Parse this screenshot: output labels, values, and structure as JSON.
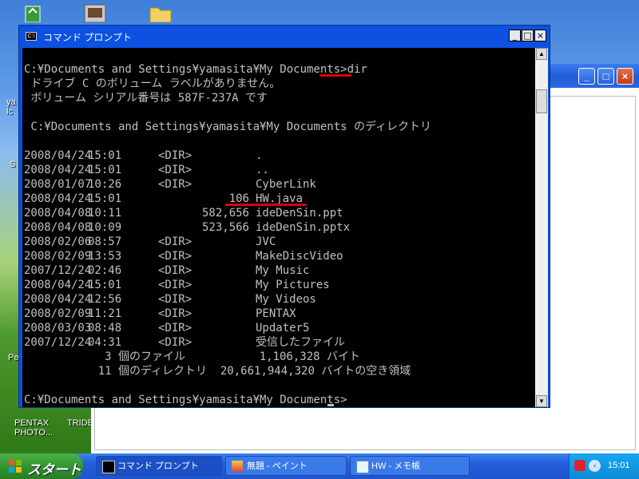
{
  "desktop": {
    "icons": [
      {
        "name": "recycle-bin-icon"
      },
      {
        "name": "program-icon"
      },
      {
        "name": "folder-icon"
      }
    ],
    "labels": [
      {
        "text": "PENTAX\nPHOTO..."
      },
      {
        "text": "TRIDE"
      }
    ],
    "partial_labels": [
      "ya",
      "lc",
      "S",
      "Pe"
    ]
  },
  "console": {
    "title": "コマンド プロンプト",
    "icon_text": "C:\\",
    "buttons": {
      "minimize": "_",
      "maximize": "□",
      "close": "×"
    },
    "lines": [
      "",
      "C:¥Documents and Settings¥yamasita¥My Documents>dir",
      " ドライブ C のボリューム ラベルがありません。",
      " ボリューム シリアル番号は 587F-237A です",
      "",
      " C:¥Documents and Settings¥yamasita¥My Documents のディレクトリ",
      ""
    ],
    "entries": [
      {
        "date": "2008/04/24",
        "time": "15:01",
        "type": "<DIR>",
        "size": "",
        "name": "."
      },
      {
        "date": "2008/04/24",
        "time": "15:01",
        "type": "<DIR>",
        "size": "",
        "name": ".."
      },
      {
        "date": "2008/01/07",
        "time": "10:26",
        "type": "<DIR>",
        "size": "",
        "name": "CyberLink"
      },
      {
        "date": "2008/04/24",
        "time": "15:01",
        "type": "",
        "size": "106",
        "name": "HW.java"
      },
      {
        "date": "2008/04/08",
        "time": "10:11",
        "type": "",
        "size": "582,656",
        "name": "ideDenSin.ppt"
      },
      {
        "date": "2008/04/08",
        "time": "10:09",
        "type": "",
        "size": "523,566",
        "name": "ideDenSin.pptx"
      },
      {
        "date": "2008/02/06",
        "time": "08:57",
        "type": "<DIR>",
        "size": "",
        "name": "JVC"
      },
      {
        "date": "2008/02/09",
        "time": "13:53",
        "type": "<DIR>",
        "size": "",
        "name": "MakeDiscVideo"
      },
      {
        "date": "2007/12/24",
        "time": "02:46",
        "type": "<DIR>",
        "size": "",
        "name": "My Music"
      },
      {
        "date": "2008/04/24",
        "time": "15:01",
        "type": "<DIR>",
        "size": "",
        "name": "My Pictures"
      },
      {
        "date": "2008/04/24",
        "time": "12:56",
        "type": "<DIR>",
        "size": "",
        "name": "My Videos"
      },
      {
        "date": "2008/02/09",
        "time": "11:21",
        "type": "<DIR>",
        "size": "",
        "name": "PENTAX"
      },
      {
        "date": "2008/03/03",
        "time": "08:48",
        "type": "<DIR>",
        "size": "",
        "name": "Updater5"
      },
      {
        "date": "2007/12/24",
        "time": "04:31",
        "type": "<DIR>",
        "size": "",
        "name": "受信したファイル"
      }
    ],
    "summary": [
      "            3 個のファイル           1,106,328 バイト",
      "           11 個のディレクトリ  20,661,944,320 バイトの空き領域"
    ],
    "prompt": "C:¥Documents and Settings¥yamasita¥My Documents>",
    "annotation_color": "#e00000"
  },
  "taskbar": {
    "start_label": "スタート",
    "items": [
      {
        "label": "コマンド プロンプト",
        "icon": "console-icon"
      },
      {
        "label": "無題 - ペイント",
        "icon": "paint-icon"
      },
      {
        "label": "HW - メモ帳",
        "icon": "notepad-icon"
      }
    ],
    "clock": "15:01"
  }
}
